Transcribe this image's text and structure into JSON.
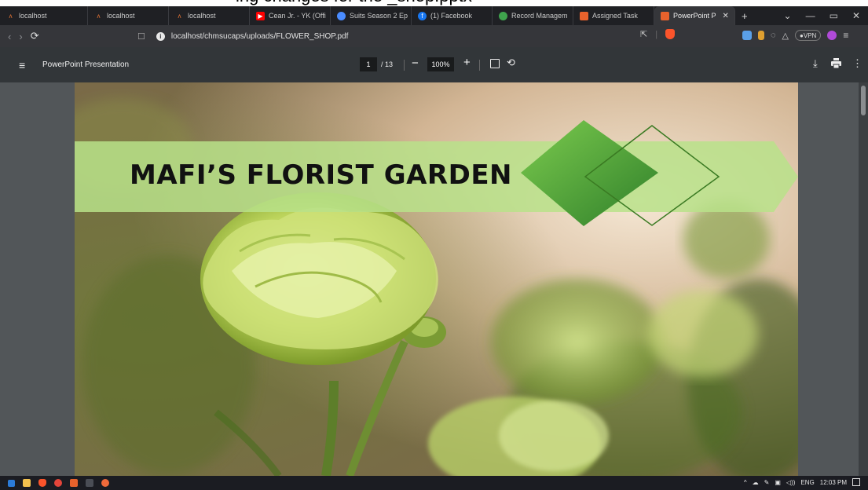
{
  "browser": {
    "tabs": [
      {
        "label": "localhost",
        "icon": "xampp-icon",
        "color": "#f27935"
      },
      {
        "label": "localhost",
        "icon": "xampp-icon",
        "color": "#f27935"
      },
      {
        "label": "localhost",
        "icon": "xampp-icon",
        "color": "#f27935"
      },
      {
        "label": "Cean Jr. - YK (Offi",
        "icon": "youtube-icon",
        "color": "#ff0000"
      },
      {
        "label": "Suits Season 2 Ep",
        "icon": "globe-icon",
        "color": "#4a8cff"
      },
      {
        "label": "(1) Facebook",
        "icon": "facebook-icon",
        "color": "#1877f2"
      },
      {
        "label": "Record Managem",
        "icon": "app-icon",
        "color": "#3fa34d"
      },
      {
        "label": "Assigned Task",
        "icon": "ppt-icon",
        "color": "#e8622c"
      },
      {
        "label": "PowerPoint P",
        "icon": "ppt-icon",
        "color": "#e8622c",
        "active": true
      }
    ],
    "new_tab": "+",
    "url": "localhost/chmsucaps/uploads/FLOWER_SHOP.pdf",
    "vpn_label": "VPN"
  },
  "pdf": {
    "title": "PowerPoint Presentation",
    "page": "1",
    "total": "/ 13",
    "zoom": "100%"
  },
  "slide": {
    "title": "MAFI’S FLORIST GARDEN"
  },
  "taskbar": {
    "lang": "ENG",
    "time": "12:03 PM"
  },
  "colors": {
    "tabbar": "#1f2024",
    "toolbar": "#35363a",
    "pdf_toolbar": "#323639",
    "viewer_bg": "#525659",
    "banner": "#c6e89a",
    "diamond": "#56a63a"
  }
}
